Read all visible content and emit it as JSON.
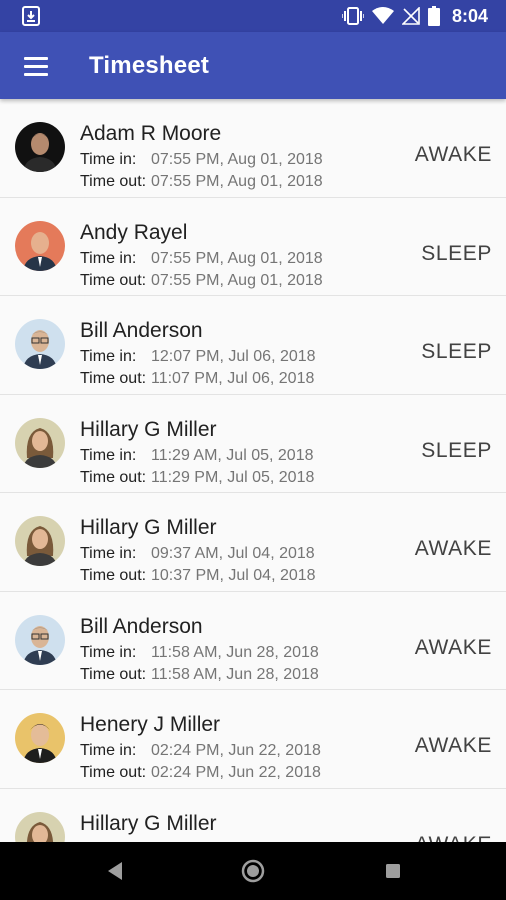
{
  "status_bar": {
    "time": "8:04",
    "icons": [
      "download-icon",
      "vibrate-icon",
      "wifi-icon",
      "no-signal-icon",
      "battery-icon"
    ]
  },
  "app_bar": {
    "title": "Timesheet",
    "menu_icon": "hamburger-menu-icon"
  },
  "labels": {
    "time_in": "Time in:",
    "time_out": "Time out:"
  },
  "entries": [
    {
      "name": "Adam R Moore",
      "time_in": "07:55 PM, Aug 01, 2018",
      "time_out": "07:55 PM, Aug 01, 2018",
      "status": "AWAKE"
    },
    {
      "name": "Andy Rayel",
      "time_in": "07:55 PM, Aug 01, 2018",
      "time_out": "07:55 PM, Aug 01, 2018",
      "status": "SLEEP"
    },
    {
      "name": "Bill Anderson",
      "time_in": "12:07 PM, Jul 06, 2018",
      "time_out": "11:07 PM, Jul 06, 2018",
      "status": "SLEEP"
    },
    {
      "name": "Hillary G Miller",
      "time_in": "11:29 AM, Jul 05, 2018",
      "time_out": "11:29 PM, Jul 05, 2018",
      "status": "SLEEP"
    },
    {
      "name": "Hillary G Miller",
      "time_in": "09:37 AM, Jul 04, 2018",
      "time_out": "10:37 PM, Jul 04, 2018",
      "status": "AWAKE"
    },
    {
      "name": "Bill Anderson",
      "time_in": "11:58 AM, Jun 28, 2018",
      "time_out": "11:58 AM, Jun 28, 2018",
      "status": "AWAKE"
    },
    {
      "name": "Henery J Miller",
      "time_in": "02:24 PM, Jun 22, 2018",
      "time_out": "02:24 PM, Jun 22, 2018",
      "status": "AWAKE"
    },
    {
      "name": "Hillary G Miller",
      "time_in": "",
      "time_out": "",
      "status": "AWAKE"
    }
  ],
  "colors": {
    "status_bar": "#3443a4",
    "app_bar": "#3f51b5",
    "background": "#fafafa",
    "nav_bar": "#000000"
  },
  "nav_bar": {
    "icons": [
      "back-icon",
      "home-icon",
      "recents-icon"
    ]
  }
}
